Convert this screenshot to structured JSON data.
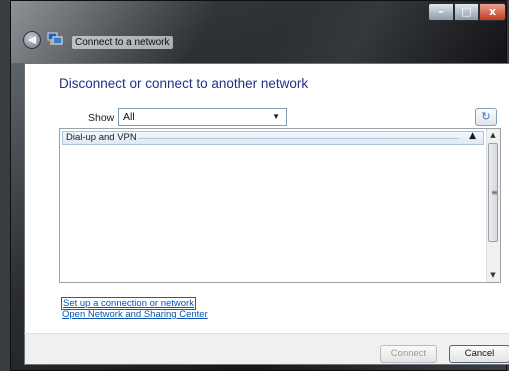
{
  "window": {
    "title": "Connect to a network",
    "controls": {
      "minimize": "–",
      "maximize": "□",
      "close": "x"
    },
    "back_icon": "back-arrow-icon"
  },
  "main": {
    "heading": "Disconnect or connect to another network",
    "show_label": "Show",
    "show_selected": "All",
    "refresh_icon": "refresh-icon",
    "list": {
      "groups": [
        {
          "label": "Dial-up and VPN",
          "collapsed_glyph": "▲"
        }
      ]
    },
    "links": {
      "setup": "Set up a connection or network",
      "open_center": "Open Network and Sharing Center"
    }
  },
  "footer": {
    "connect_label": "Connect",
    "cancel_label": "Cancel"
  },
  "colors": {
    "heading": "#1e3287",
    "link": "#0a55b4",
    "highlight_border": "#cc2020"
  }
}
